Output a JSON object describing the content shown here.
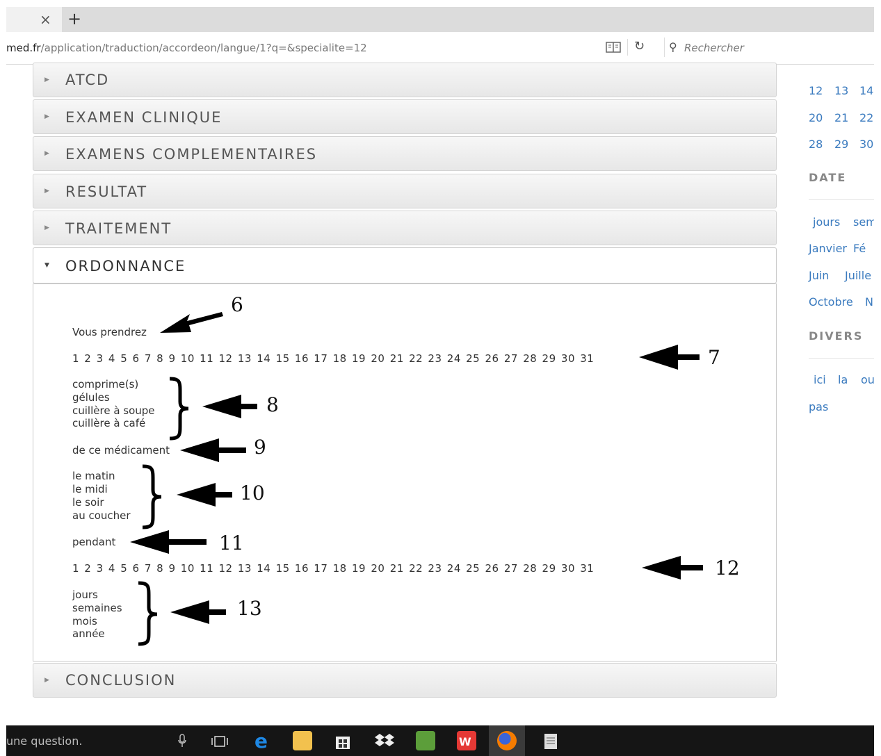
{
  "browser": {
    "tab_close": "×",
    "new_tab": "+",
    "url_domain": "med.fr",
    "url_path": "/application/traduction/accordeon/langue/1?q=&specialite=12",
    "search_placeholder": "Rechercher"
  },
  "accordion": {
    "sections": [
      "ATCD",
      "EXAMEN CLINIQUE",
      "EXAMENS COMPLEMENTAIRES",
      "RESULTAT",
      "TRAITEMENT",
      "ORDONNANCE",
      "CONCLUSION"
    ]
  },
  "ordonnance": {
    "vous_prendrez": "Vous prendrez",
    "numbers_row": "1 2 3 4 5 6 7 8 9 10 11 12 13 14 15 16 17 18 19 20 21 22 23 24 25 26 27 28 29 30 31",
    "units": [
      "comprime(s)",
      "gélules",
      "cuillère à soupe",
      "cuillère à café"
    ],
    "de_ce_medicament": "de ce médicament",
    "moments": [
      "le matin",
      "le midi",
      "le soir",
      "au coucher"
    ],
    "pendant": "pendant",
    "durations": [
      "jours",
      "semaines",
      "mois",
      "année"
    ],
    "annotations": [
      "6",
      "7",
      "8",
      "9",
      "10",
      "11",
      "12",
      "13"
    ]
  },
  "sidebar": {
    "cal_row1": [
      "12",
      "13",
      "14"
    ],
    "cal_row2": [
      "20",
      "21",
      "22"
    ],
    "cal_row3": [
      "28",
      "29",
      "30"
    ],
    "date_heading": "DATE",
    "date_items": [
      "jours",
      "sem",
      "Janvier",
      "Fé",
      "Juin",
      "Juille",
      "Octobre",
      "N"
    ],
    "divers_heading": "DIVERS",
    "divers_items": [
      "ici",
      "la",
      "ou",
      "pas"
    ]
  },
  "taskbar": {
    "search_text": "une question."
  }
}
